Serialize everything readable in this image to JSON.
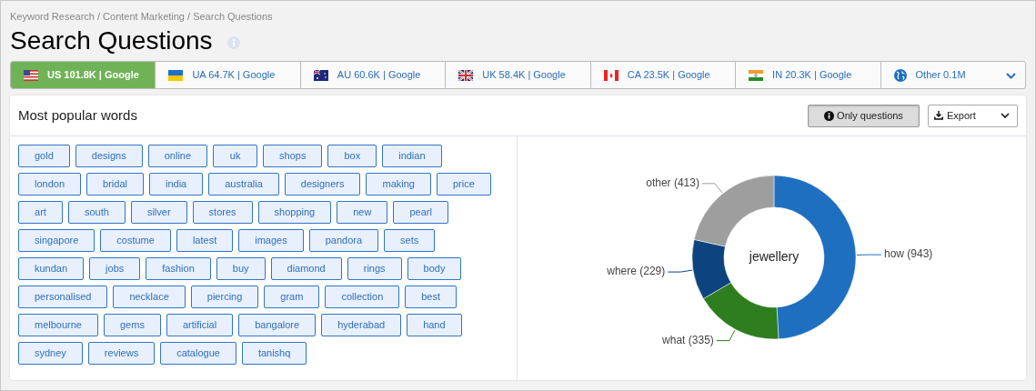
{
  "breadcrumb": "Keyword Research / Content Marketing / Search Questions",
  "title": "Search Questions",
  "tabs": [
    {
      "label": "US 101.8K | Google",
      "selected": true
    },
    {
      "label": "UA 64.7K | Google",
      "selected": false
    },
    {
      "label": "AU 60.6K | Google",
      "selected": false
    },
    {
      "label": "UK 58.4K | Google",
      "selected": false
    },
    {
      "label": "CA 23.5K | Google",
      "selected": false
    },
    {
      "label": "IN 20.3K | Google",
      "selected": false
    },
    {
      "label": "Other 0.1M",
      "selected": false
    }
  ],
  "panel": {
    "title": "Most popular words",
    "buttons": [
      {
        "label": "Only questions",
        "selected": true
      },
      {
        "label": "Export",
        "selected": false
      }
    ]
  },
  "word_rows": [
    [
      "gold",
      "designs",
      "online",
      "uk",
      "shops",
      "box",
      "indian"
    ],
    [
      "london",
      "bridal",
      "india",
      "australia",
      "designers",
      "making",
      "price"
    ],
    [
      "art",
      "south",
      "silver",
      "stores",
      "shopping",
      "new",
      "pearl"
    ],
    [
      "singapore",
      "costume",
      "latest",
      "images",
      "pandora",
      "sets"
    ],
    [
      "kundan",
      "jobs",
      "fashion",
      "buy",
      "diamond",
      "rings",
      "body"
    ],
    [
      "personalised",
      "necklace",
      "piercing",
      "gram",
      "collection",
      "best"
    ],
    [
      "melbourne",
      "gems",
      "artificial",
      "bangalore",
      "hyderabad",
      "hand"
    ],
    [
      "sydney",
      "reviews",
      "catalogue",
      "tanishq"
    ]
  ],
  "chart": {
    "center_label": "jewellery",
    "chart_data": {
      "type": "donut",
      "categories": [
        "how (943)",
        "what (335)",
        "where (229)",
        "other (413)"
      ],
      "values": [
        943,
        335,
        229,
        413
      ],
      "colors": [
        "#1f6fc0",
        "#2e7d1e",
        "#0d447f",
        "#9e9e9e"
      ]
    }
  }
}
